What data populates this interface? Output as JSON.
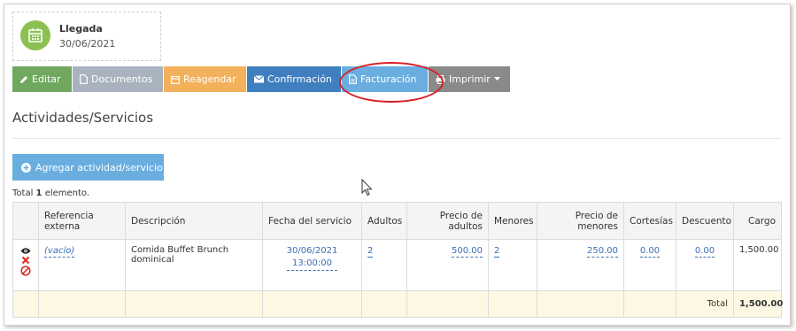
{
  "arrival": {
    "title": "Llegada",
    "date": "30/06/2021"
  },
  "toolbar": {
    "edit": "Editar",
    "documents": "Documentos",
    "reschedule": "Reagendar",
    "confirmation": "Confirmación",
    "billing": "Facturación",
    "print": "Imprimir"
  },
  "section": {
    "title": "Actividades/Servicios"
  },
  "add_button": "Agregar actividad/servicio",
  "total_count": {
    "prefix": "Total ",
    "number": "1",
    "suffix": " elemento."
  },
  "table": {
    "headers": [
      "Referencia externa",
      "Descripción",
      "Fecha del servicio",
      "Adultos",
      "Precio de adultos",
      "Menores",
      "Precio de menores",
      "Cortesías",
      "Descuento",
      "Cargo"
    ],
    "row": {
      "reference": "(vacío)",
      "description": "Comida Buffet Brunch dominical",
      "service_date": "30/06/2021",
      "service_time": "13:00:00",
      "adults": "2",
      "adult_price": "500.00",
      "minors": "2",
      "minor_price": "250.00",
      "courtesies": "0.00",
      "discount": "0.00",
      "charge": "1,500.00"
    },
    "footer": {
      "label": "Total",
      "value": "1,500.00"
    }
  },
  "colors": {
    "edit": "#70a860",
    "documents": "#a9b3bf",
    "reschedule": "#f2b15a",
    "confirmation": "#3f7fbf",
    "billing": "#6aaee0",
    "print": "#8a8a8a",
    "highlight": "#d81f26"
  }
}
